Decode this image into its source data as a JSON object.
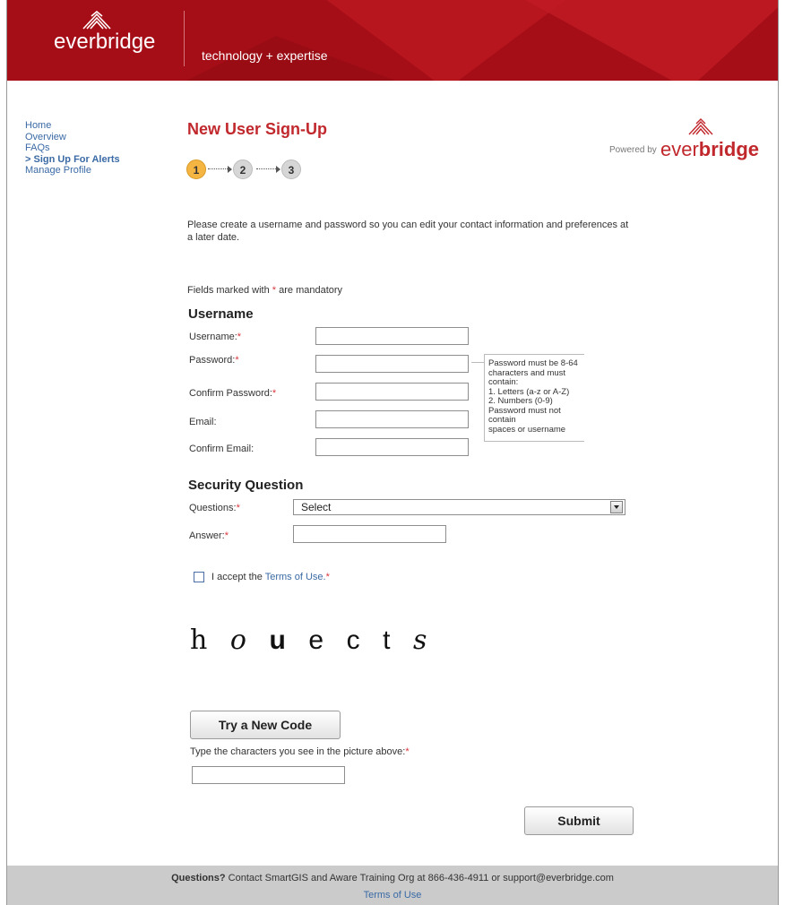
{
  "header": {
    "brand": "everbridge",
    "tagline": "technology + expertise"
  },
  "nav": {
    "items": [
      {
        "label": "Home"
      },
      {
        "label": "Overview"
      },
      {
        "label": "FAQs"
      },
      {
        "label": "> Sign Up For Alerts",
        "active": true
      },
      {
        "label": "Manage Profile"
      }
    ]
  },
  "page": {
    "title": "New User Sign-Up",
    "steps": [
      "1",
      "2",
      "3"
    ],
    "current_step": 1,
    "powered_by": "Powered by",
    "powered_brand_light": "ever",
    "powered_brand_bold": "bridge",
    "intro": "Please create a username and password so you can edit your contact information and preferences at a later date.",
    "mandatory_prefix": "Fields marked with",
    "mandatory_star": "*",
    "mandatory_suffix": "are mandatory"
  },
  "username_section": {
    "heading": "Username",
    "fields": {
      "username": {
        "label": "Username:",
        "value": ""
      },
      "password": {
        "label": "Password:",
        "value": ""
      },
      "confirm_password": {
        "label": "Confirm Password:",
        "value": ""
      },
      "email": {
        "label": "Email:",
        "value": ""
      },
      "confirm_email": {
        "label": "Confirm Email:",
        "value": ""
      }
    },
    "password_hint": [
      "Password must be 8-64",
      "characters and must contain:",
      "1. Letters (a-z or A-Z)",
      "2. Numbers (0-9)",
      "Password must not contain",
      "spaces or username"
    ]
  },
  "security_section": {
    "heading": "Security Question",
    "questions_label": "Questions:",
    "questions_selected": "Select",
    "answer_label": "Answer:",
    "answer_value": ""
  },
  "terms": {
    "prefix": "I accept the",
    "link": "Terms of Use.",
    "checked": false
  },
  "captcha": {
    "chars": [
      "h",
      "o",
      "u",
      "e",
      "c",
      "t",
      "s"
    ],
    "new_code_button": "Try a New Code",
    "prompt": "Type the characters you see in the picture above:",
    "value": ""
  },
  "submit_label": "Submit",
  "required_star": "*",
  "footer": {
    "questions": "Questions?",
    "contact": "Contact SmartGIS and Aware Training Org at 866-436-4911 or support@everbridge.com",
    "terms_link": "Terms of Use"
  },
  "colors": {
    "header_red": "#a50e17",
    "title_red": "#c1282d",
    "link_blue": "#3a6aa5",
    "step_active": "#f5b542"
  }
}
